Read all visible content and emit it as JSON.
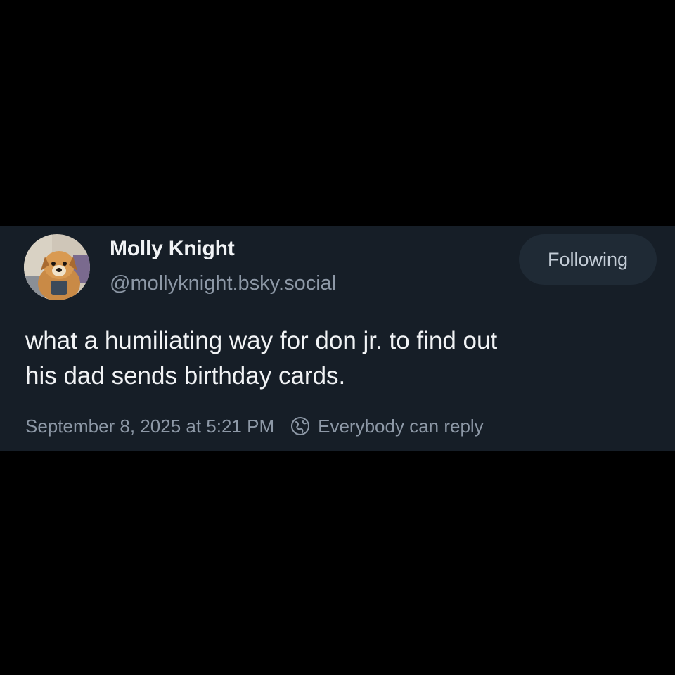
{
  "post": {
    "author": {
      "display_name": "Molly Knight",
      "handle": "@mollyknight.bsky.social",
      "avatar_icon": "dog-photo-avatar"
    },
    "follow_button_label": "Following",
    "text_lines": [
      "what a humiliating way for don jr. to find out",
      "his dad sends birthday cards."
    ],
    "timestamp": "September 8, 2025 at 5:21 PM",
    "reply_setting_icon": "globe-icon",
    "reply_setting": "Everybody can reply"
  },
  "colors": {
    "page_background": "#000000",
    "card_background": "#161e27",
    "primary_text": "#f1f3f5",
    "secondary_text": "#8d98a6",
    "button_background": "#1f2a35"
  }
}
